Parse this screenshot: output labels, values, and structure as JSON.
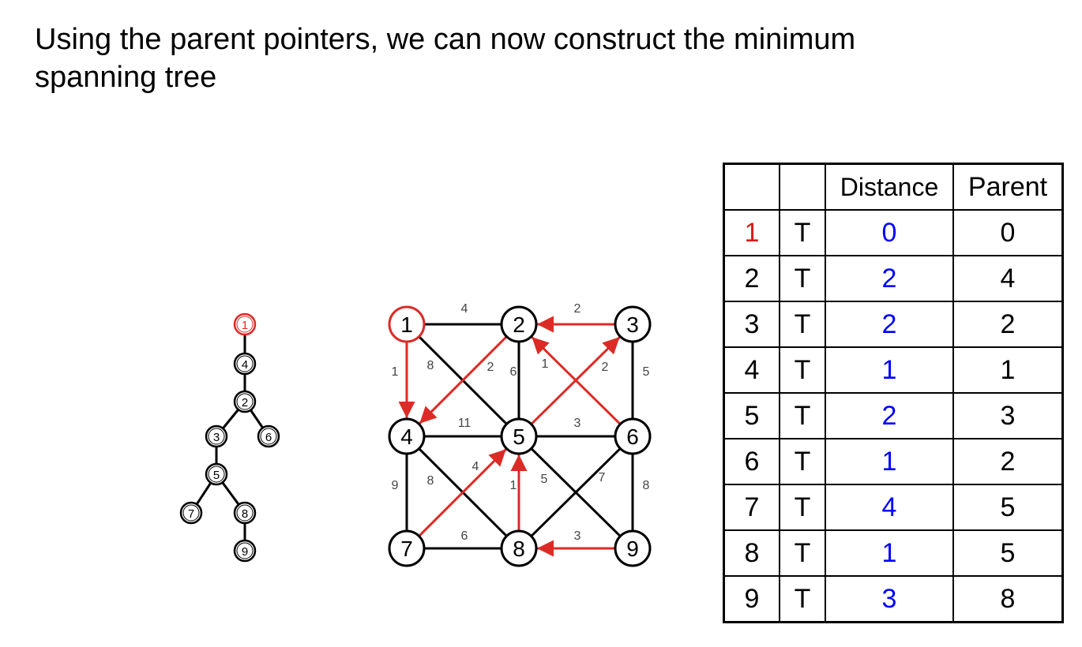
{
  "title": "Using the parent pointers, we can now construct the minimum spanning tree",
  "colors": {
    "highlight": "#dc2b26",
    "distance": "#0000ff",
    "first_vertex": "#e0191a"
  },
  "table": {
    "headers": [
      "",
      "",
      "Distance",
      "Parent"
    ],
    "rows": [
      {
        "vertex": "1",
        "known": "T",
        "distance": "0",
        "parent": "0"
      },
      {
        "vertex": "2",
        "known": "T",
        "distance": "2",
        "parent": "4"
      },
      {
        "vertex": "3",
        "known": "T",
        "distance": "2",
        "parent": "2"
      },
      {
        "vertex": "4",
        "known": "T",
        "distance": "1",
        "parent": "1"
      },
      {
        "vertex": "5",
        "known": "T",
        "distance": "2",
        "parent": "3"
      },
      {
        "vertex": "6",
        "known": "T",
        "distance": "1",
        "parent": "2"
      },
      {
        "vertex": "7",
        "known": "T",
        "distance": "4",
        "parent": "5"
      },
      {
        "vertex": "8",
        "known": "T",
        "distance": "1",
        "parent": "5"
      },
      {
        "vertex": "9",
        "known": "T",
        "distance": "3",
        "parent": "8"
      }
    ]
  },
  "graph": {
    "nodes": [
      "1",
      "2",
      "3",
      "4",
      "5",
      "6",
      "7",
      "8",
      "9"
    ],
    "edges": [
      {
        "from": "1",
        "to": "2",
        "weight": "4",
        "tree": false
      },
      {
        "from": "3",
        "to": "2",
        "weight": "2",
        "tree": true
      },
      {
        "from": "1",
        "to": "4",
        "weight": "1",
        "tree": true
      },
      {
        "from": "1",
        "to": "5",
        "weight": "8",
        "tree": false
      },
      {
        "from": "2",
        "to": "4",
        "weight": "2",
        "tree": true
      },
      {
        "from": "2",
        "to": "5",
        "weight": "6",
        "tree": false
      },
      {
        "from": "6",
        "to": "2",
        "weight": "1",
        "tree": true
      },
      {
        "from": "5",
        "to": "3",
        "weight": "2",
        "tree": true
      },
      {
        "from": "3",
        "to": "6",
        "weight": "5",
        "tree": false
      },
      {
        "from": "4",
        "to": "5",
        "weight": "11",
        "tree": false
      },
      {
        "from": "5",
        "to": "6",
        "weight": "3",
        "tree": false
      },
      {
        "from": "4",
        "to": "7",
        "weight": "9",
        "tree": false
      },
      {
        "from": "4",
        "to": "8",
        "weight": "8",
        "tree": false
      },
      {
        "from": "7",
        "to": "5",
        "weight": "4",
        "tree": true
      },
      {
        "from": "8",
        "to": "5",
        "weight": "1",
        "tree": true
      },
      {
        "from": "5",
        "to": "9",
        "weight": "5",
        "tree": false
      },
      {
        "from": "6",
        "to": "8",
        "weight": "7",
        "tree": false
      },
      {
        "from": "6",
        "to": "9",
        "weight": "8",
        "tree": false
      },
      {
        "from": "7",
        "to": "8",
        "weight": "6",
        "tree": false
      },
      {
        "from": "9",
        "to": "8",
        "weight": "3",
        "tree": true
      }
    ]
  },
  "tree": {
    "root": "1",
    "nodes": [
      "1",
      "4",
      "2",
      "3",
      "6",
      "5",
      "7",
      "8",
      "9"
    ]
  }
}
